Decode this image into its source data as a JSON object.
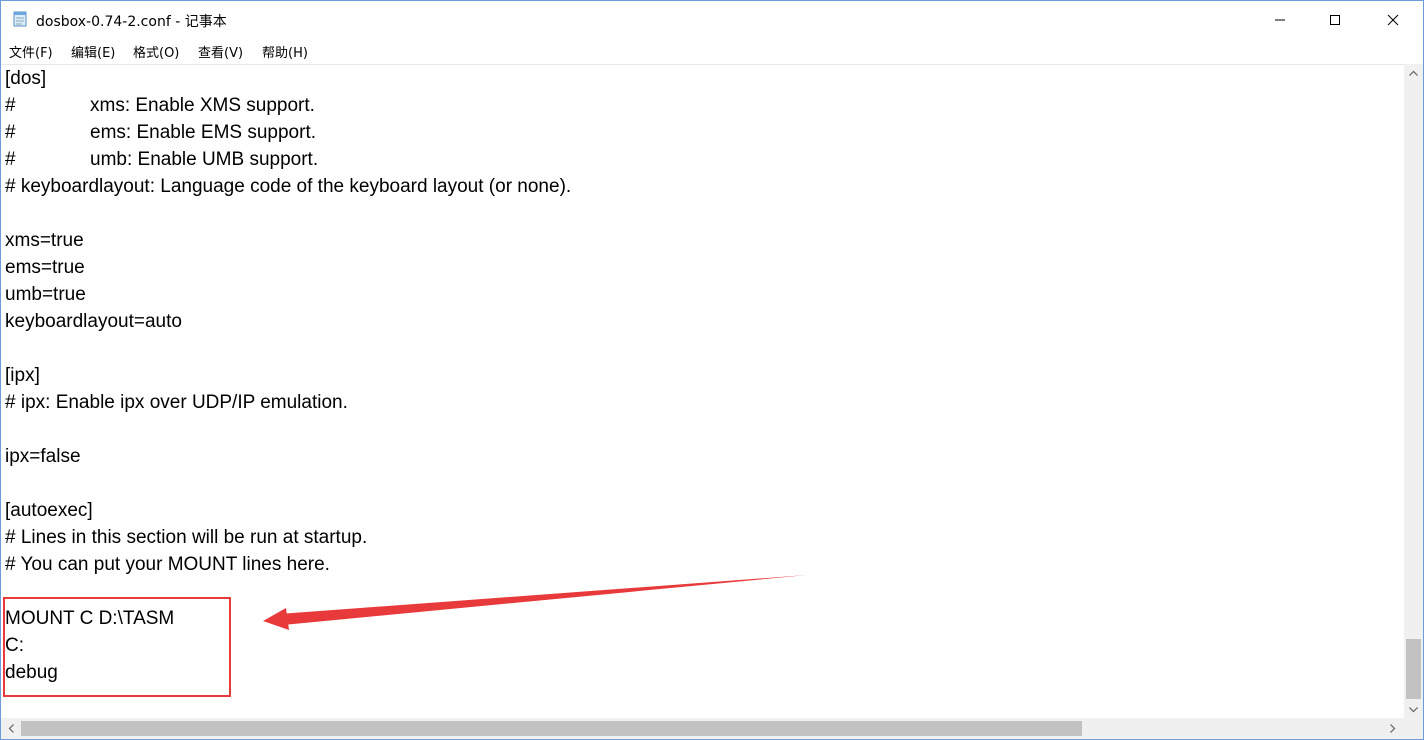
{
  "window": {
    "title": "dosbox-0.74-2.conf - 记事本"
  },
  "menu": {
    "file": "文件(F)",
    "edit": "编辑(E)",
    "format": "格式(O)",
    "view": "查看(V)",
    "help": "帮助(H)"
  },
  "editor": {
    "lines": [
      "[dos]",
      "xms: Enable XMS support.",
      "ems: Enable EMS support.",
      "umb: Enable UMB support.",
      "# keyboardlayout: Language code of the keyboard layout (or none).",
      "",
      "xms=true",
      "ems=true",
      "umb=true",
      "keyboardlayout=auto",
      "",
      "[ipx]",
      "# ipx: Enable ipx over UDP/IP emulation.",
      "",
      "ipx=false",
      "",
      "[autoexec]",
      "# Lines in this section will be run at startup.",
      "# You can put your MOUNT lines here.",
      "",
      "MOUNT C D:\\TASM",
      "C:",
      "debug"
    ],
    "hash": "#"
  },
  "colors": {
    "annotation": "#e83a3a",
    "window_border": "#6b9ed8"
  }
}
